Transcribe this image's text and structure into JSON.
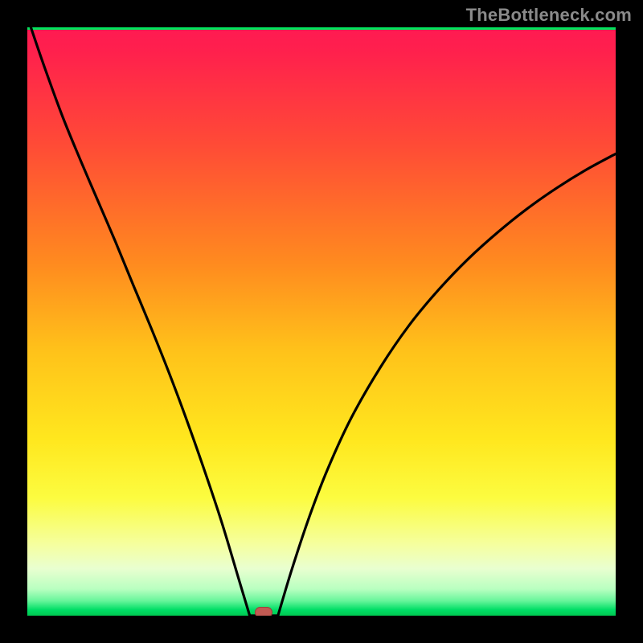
{
  "watermark": "TheBottleneck.com",
  "colors": {
    "frame_bg": "#000000",
    "gradient_stops": [
      {
        "offset": 0.0,
        "color": "#ff1a52"
      },
      {
        "offset": 0.04,
        "color": "#ff204d"
      },
      {
        "offset": 0.2,
        "color": "#ff4b36"
      },
      {
        "offset": 0.4,
        "color": "#ff8a1f"
      },
      {
        "offset": 0.55,
        "color": "#ffc21a"
      },
      {
        "offset": 0.7,
        "color": "#ffe71e"
      },
      {
        "offset": 0.8,
        "color": "#fcfc40"
      },
      {
        "offset": 0.88,
        "color": "#f5ffa0"
      },
      {
        "offset": 0.92,
        "color": "#e9ffd0"
      },
      {
        "offset": 0.955,
        "color": "#b8ffc0"
      },
      {
        "offset": 0.975,
        "color": "#66f59a"
      },
      {
        "offset": 0.99,
        "color": "#00de66"
      },
      {
        "offset": 1.0,
        "color": "#00c851"
      }
    ],
    "curve": "#000000",
    "marker_fill": "#c25a53",
    "marker_stroke": "#9a3f3a"
  },
  "chart_data": {
    "type": "line",
    "x_range": [
      0,
      100
    ],
    "y_range": [
      0,
      100
    ],
    "minimum_x": 40.2,
    "flat_bottom": {
      "x_start": 37.8,
      "x_end": 42.6,
      "y": 0
    },
    "left_branch": [
      {
        "x": 0.6,
        "y": 100
      },
      {
        "x": 3.0,
        "y": 93.0
      },
      {
        "x": 6.0,
        "y": 84.8
      },
      {
        "x": 9.0,
        "y": 77.5
      },
      {
        "x": 12.0,
        "y": 70.5
      },
      {
        "x": 15.0,
        "y": 63.5
      },
      {
        "x": 18.0,
        "y": 56.2
      },
      {
        "x": 21.0,
        "y": 49.0
      },
      {
        "x": 24.0,
        "y": 41.5
      },
      {
        "x": 27.0,
        "y": 33.5
      },
      {
        "x": 30.0,
        "y": 25.0
      },
      {
        "x": 33.0,
        "y": 16.0
      },
      {
        "x": 36.0,
        "y": 6.0
      },
      {
        "x": 37.8,
        "y": 0.0
      }
    ],
    "right_branch": [
      {
        "x": 42.6,
        "y": 0.0
      },
      {
        "x": 45.0,
        "y": 8.0
      },
      {
        "x": 48.0,
        "y": 17.0
      },
      {
        "x": 51.0,
        "y": 24.8
      },
      {
        "x": 55.0,
        "y": 33.5
      },
      {
        "x": 60.0,
        "y": 42.2
      },
      {
        "x": 65.0,
        "y": 49.5
      },
      {
        "x": 70.0,
        "y": 55.5
      },
      {
        "x": 75.0,
        "y": 60.7
      },
      {
        "x": 80.0,
        "y": 65.2
      },
      {
        "x": 85.0,
        "y": 69.2
      },
      {
        "x": 90.0,
        "y": 72.7
      },
      {
        "x": 95.0,
        "y": 75.8
      },
      {
        "x": 100.0,
        "y": 78.5
      }
    ],
    "marker": {
      "x": 40.2,
      "y": 0.5
    }
  }
}
